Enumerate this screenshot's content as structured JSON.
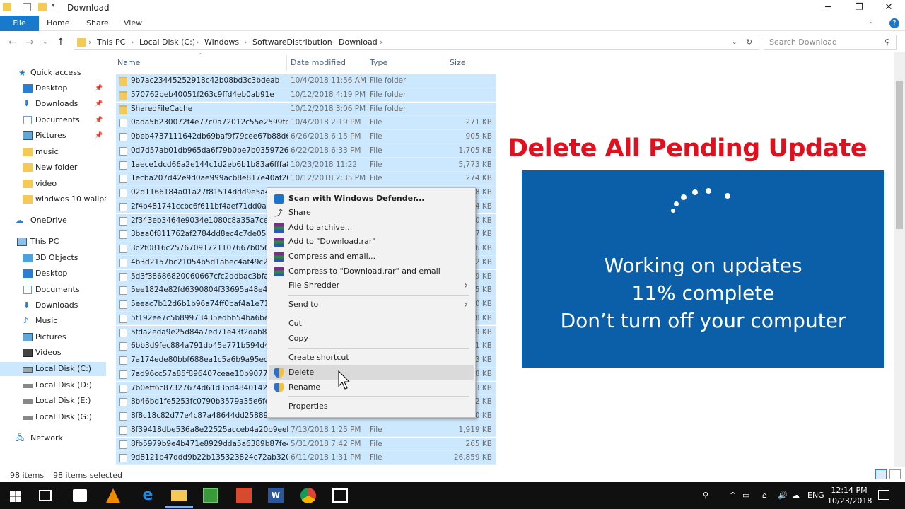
{
  "window": {
    "title": "Download"
  },
  "ribbon": {
    "tabs": [
      "File",
      "Home",
      "Share",
      "View"
    ]
  },
  "address": {
    "crumbs": [
      "This PC",
      "Local Disk (C:)",
      "Windows",
      "SoftwareDistribution",
      "Download"
    ],
    "search_placeholder": "Search Download"
  },
  "nav": {
    "items": [
      {
        "label": "Quick access"
      },
      {
        "label": "Desktop"
      },
      {
        "label": "Downloads"
      },
      {
        "label": "Documents"
      },
      {
        "label": "Pictures"
      },
      {
        "label": "music"
      },
      {
        "label": "New folder"
      },
      {
        "label": "video"
      },
      {
        "label": "windwos 10 wallpap"
      },
      {
        "label": "OneDrive"
      },
      {
        "label": "This PC"
      },
      {
        "label": "3D Objects"
      },
      {
        "label": "Desktop"
      },
      {
        "label": "Documents"
      },
      {
        "label": "Downloads"
      },
      {
        "label": "Music"
      },
      {
        "label": "Pictures"
      },
      {
        "label": "Videos"
      },
      {
        "label": "Local Disk (C:)"
      },
      {
        "label": "Local Disk (D:)"
      },
      {
        "label": "Local Disk (E:)"
      },
      {
        "label": "Local Disk (G:)"
      },
      {
        "label": "Network"
      }
    ]
  },
  "columns": {
    "name": "Name",
    "date": "Date modified",
    "type": "Type",
    "size": "Size"
  },
  "files": [
    {
      "name": "9b7ac23445252918c42b08bd3c3bdeab",
      "date": "10/4/2018 11:56 AM",
      "type": "File folder",
      "size": "",
      "kind": "folder"
    },
    {
      "name": "570762beb40051f263c9ffd4eb0ab91e",
      "date": "10/12/2018 4:19 PM",
      "type": "File folder",
      "size": "",
      "kind": "folder"
    },
    {
      "name": "SharedFileCache",
      "date": "10/12/2018 3:06 PM",
      "type": "File folder",
      "size": "",
      "kind": "folder"
    },
    {
      "name": "0ada5b230072f4e77c0a72012c55e2599fb1...",
      "date": "10/4/2018 2:19 PM",
      "type": "File",
      "size": "271 KB",
      "kind": "file"
    },
    {
      "name": "0beb4737111642db69baf9f79cee67b88d6...",
      "date": "6/26/2018 6:15 PM",
      "type": "File",
      "size": "905 KB",
      "kind": "file"
    },
    {
      "name": "0d7d57ab01db965da6f79b0be7b0359726c...",
      "date": "6/22/2018 6:33 PM",
      "type": "File",
      "size": "1,705 KB",
      "kind": "file"
    },
    {
      "name": "1aece1dcd66a2e144c1d2eb6b1b83a6fffa8...",
      "date": "10/23/2018 11:22",
      "type": "File",
      "size": "5,773 KB",
      "kind": "file"
    },
    {
      "name": "1ecba207d42e9d0ae999acb8e817e40af26...",
      "date": "10/12/2018 2:35 PM",
      "type": "File",
      "size": "274 KB",
      "kind": "file"
    },
    {
      "name": "02d1166184a01a27f81514ddd9e5a4cb4",
      "date": "",
      "type": "",
      "size": "8 KB",
      "kind": "file"
    },
    {
      "name": "2f4b481741ccbc6f611bf4aef71dd0a01f4",
      "date": "",
      "type": "",
      "size": "4 KB",
      "kind": "file"
    },
    {
      "name": "2f343eb3464e9034e1080c8a35a7ce56d0",
      "date": "",
      "type": "",
      "size": "0 KB",
      "kind": "file"
    },
    {
      "name": "3baa0f811762af2784dd8ec4c7de05013c",
      "date": "",
      "type": "",
      "size": "7 KB",
      "kind": "file"
    },
    {
      "name": "3c2f0816c25767091721107667b0561277",
      "date": "",
      "type": "",
      "size": "6 KB",
      "kind": "file"
    },
    {
      "name": "4b3d2157bc21054b5d1abec4af49c2ae7",
      "date": "",
      "type": "",
      "size": "2 KB",
      "kind": "file"
    },
    {
      "name": "5d3f38686820060667cfc2ddbac3bfa803",
      "date": "",
      "type": "",
      "size": "9 KB",
      "kind": "file"
    },
    {
      "name": "5ee1824e82fd6390804f33695a48e496ac",
      "date": "",
      "type": "",
      "size": "5 KB",
      "kind": "file"
    },
    {
      "name": "5eeac7b12d6b1b96a74ff0baf4a1e71447",
      "date": "",
      "type": "",
      "size": "0 KB",
      "kind": "file"
    },
    {
      "name": "5f192ee7c5b89973435edbb54ba6befcfc",
      "date": "",
      "type": "",
      "size": "8 KB",
      "kind": "file"
    },
    {
      "name": "5fda2eda9e25d84a7ed71e43f2dab86fc2",
      "date": "",
      "type": "",
      "size": "9 KB",
      "kind": "file"
    },
    {
      "name": "6bb3d9fec884a791db45e771b594d4677",
      "date": "",
      "type": "",
      "size": "1 KB",
      "kind": "file"
    },
    {
      "name": "7a174ede80bbf688ea1c5a6b9a95ec2b6",
      "date": "",
      "type": "",
      "size": "3 KB",
      "kind": "file"
    },
    {
      "name": "7ad96cc57a85f896407ceae10b9077c636",
      "date": "",
      "type": "",
      "size": "8 KB",
      "kind": "file"
    },
    {
      "name": "7b0eff6c87327674d61d3bd4840142b07",
      "date": "",
      "type": "",
      "size": "3 KB",
      "kind": "file"
    },
    {
      "name": "8b46bd1fe5253fc0790b3579a35e6fe075",
      "date": "",
      "type": "",
      "size": "2 KB",
      "kind": "file"
    },
    {
      "name": "8f8c18c82d77e4c87a48644dd258895c2e",
      "date": "",
      "type": "",
      "size": "0 KB",
      "kind": "file"
    },
    {
      "name": "8f39418dbe536a8e22525acceb4a20b9eeb...",
      "date": "7/13/2018 1:25 PM",
      "type": "File",
      "size": "1,919 KB",
      "kind": "file"
    },
    {
      "name": "8fb5979b9e4b471e8929dda5a6389b87fe4...",
      "date": "5/31/2018 7:42 PM",
      "type": "File",
      "size": "265 KB",
      "kind": "file"
    },
    {
      "name": "9d8121b47ddd9b22b135323824c72ab320...",
      "date": "6/11/2018 1:31 PM",
      "type": "File",
      "size": "26,859 KB",
      "kind": "file"
    }
  ],
  "status": {
    "count": "98 items",
    "selected": "98 items selected"
  },
  "context_menu": {
    "items": [
      {
        "label": "Scan with Windows Defender...",
        "icon": "defender-icon",
        "bold": true
      },
      {
        "label": "Share",
        "icon": "share-icon"
      },
      {
        "label": "Add to archive...",
        "icon": "winrar-icon"
      },
      {
        "label": "Add to \"Download.rar\"",
        "icon": "winrar-icon"
      },
      {
        "label": "Compress and email...",
        "icon": "winrar-icon"
      },
      {
        "label": "Compress to \"Download.rar\" and email",
        "icon": "winrar-icon"
      },
      {
        "label": "File Shredder",
        "icon": "",
        "submenu": true
      },
      {
        "label": "Send to",
        "icon": "",
        "submenu": true
      },
      {
        "label": "Cut",
        "icon": ""
      },
      {
        "label": "Copy",
        "icon": ""
      },
      {
        "label": "Create shortcut",
        "icon": ""
      },
      {
        "label": "Delete",
        "icon": "shield-icon",
        "hover": true
      },
      {
        "label": "Rename",
        "icon": "shield-icon"
      },
      {
        "label": "Properties",
        "icon": ""
      }
    ]
  },
  "overlay": {
    "headline": "Delete All Pending Update",
    "update_lines": [
      "Working on updates",
      "11% complete",
      "Don’t turn off your computer"
    ],
    "colors": {
      "headline": "#e0101e",
      "panel": "#0b5ea8"
    }
  },
  "taskbar": {
    "language": "ENG",
    "time": "12:14 PM",
    "date": "10/23/2018"
  }
}
